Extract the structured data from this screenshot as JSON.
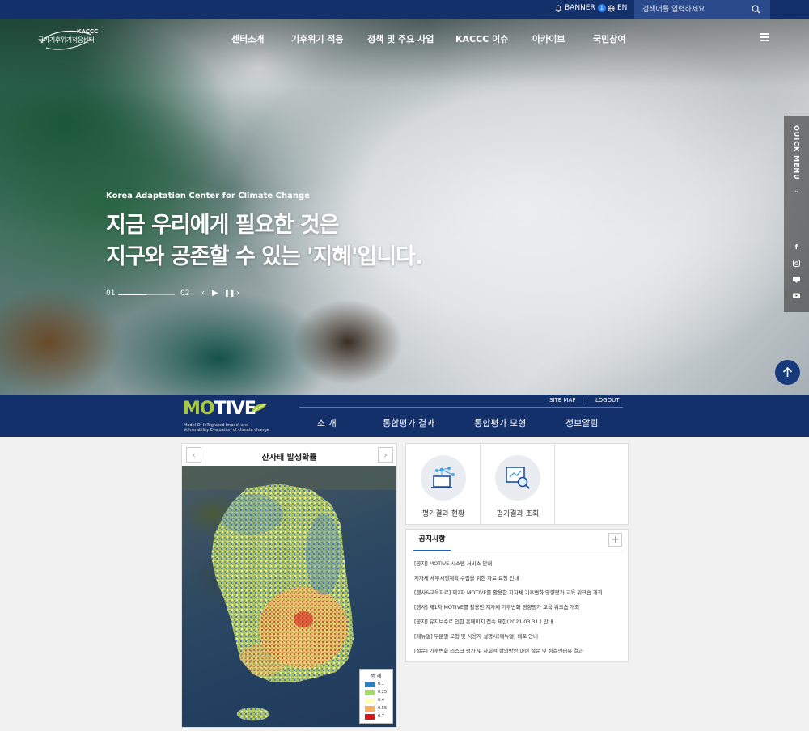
{
  "utilbar": {
    "banner_label": "BANNER",
    "banner_count": "1",
    "lang_label": "EN",
    "search_placeholder": "검색어를 입력하세요"
  },
  "logo": {
    "short": "KACCC",
    "name": "국가기후위기적응센터"
  },
  "gnb": [
    "센터소개",
    "기후위기 적응",
    "정책 및 주요 사업",
    "KACCC 이슈",
    "아카이브",
    "국민참여"
  ],
  "hero": {
    "subtitle": "Korea Adaptation Center for Climate Change",
    "title_line1": "지금 우리에게 필요한 것은",
    "title_line2": "지구와 공존할 수 있는 '지혜'입니다.",
    "current": "01",
    "total": "02",
    "progress": 0.5
  },
  "quick_menu": {
    "label": "QUICK MENU",
    "icons": [
      "facebook-icon",
      "instagram-icon",
      "blog-icon",
      "youtube-icon"
    ]
  },
  "motive": {
    "logo_green": "MO",
    "logo_white": "TIVE",
    "desc_line1": "Model Of InTegrated Impact and",
    "desc_line2": "Vulnerability Evaluation of climate change",
    "sitemap": "SITE MAP",
    "logout": "LOGOUT",
    "nav": [
      "소   개",
      "통합평가 결과",
      "통합평가 모형",
      "정보알림"
    ]
  },
  "map_panel": {
    "title": "산사태 발생확률",
    "legend_title": "범   례",
    "legend": [
      {
        "value": "0.1",
        "color": "#2f7fc1"
      },
      {
        "value": "0.25",
        "color": "#a6d96a"
      },
      {
        "value": "0.4",
        "color": "#ffffbf"
      },
      {
        "value": "0.55",
        "color": "#fdae61"
      },
      {
        "value": "0.7",
        "color": "#d7191c"
      }
    ]
  },
  "shortcuts": [
    {
      "label": "평가결과 현황"
    },
    {
      "label": "평가결과 조회"
    }
  ],
  "notice": {
    "tab": "공지사항",
    "items": [
      "[공지] MOTIVE 시스템 서비스 안내",
      "지자체 세부시행계획 수립을 위한 자료 요청 안내",
      "[행사&교육자료] 제2차 MOTIVE를 활용한 지자체 기후변화 영향평가 교육 워크숍 개최",
      "[행사] 제1차 MOTIVE를 활용한 지자체 기후변화 영향평가 교육 워크숍 개최",
      "[공지] 유지보수로 인한 홈페이지 접속 제한(2021.03.31.) 안내",
      "[매뉴얼] 부문별 모형 및 사용자 설명서(매뉴얼) 배포 안내",
      "[설문] 기후변화 리스크 평가 및 사회적 합의방안 마련 설문 및 심층인터뷰 결과"
    ]
  },
  "colors": {
    "navy": "#14306b",
    "accent_blue": "#1d5fbf",
    "motive_green": "#a8c93a"
  }
}
